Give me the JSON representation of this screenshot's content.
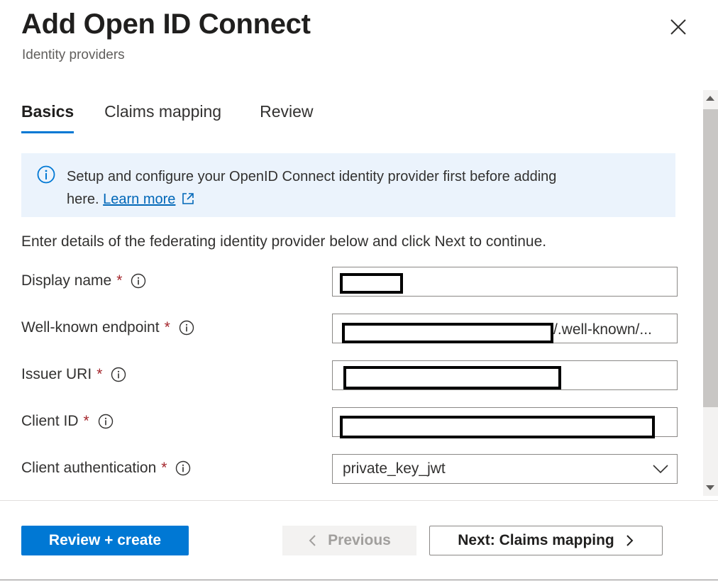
{
  "header": {
    "title": "Add Open ID Connect",
    "subtitle": "Identity providers"
  },
  "tabs": [
    {
      "label": "Basics",
      "active": true
    },
    {
      "label": "Claims mapping",
      "active": false
    },
    {
      "label": "Review",
      "active": false
    }
  ],
  "info": {
    "text_line1": "Setup and configure your OpenID Connect identity provider first before adding",
    "text_line2": "here.",
    "link_label": "Learn more"
  },
  "form": {
    "intro": "Enter details of the federating identity provider below and click Next to continue.",
    "required_mark": "*",
    "display_name": {
      "label": "Display name"
    },
    "well_known": {
      "label": "Well-known endpoint",
      "value_suffix": "/.well-known/..."
    },
    "issuer_uri": {
      "label": "Issuer URI"
    },
    "client_id": {
      "label": "Client ID"
    },
    "client_auth": {
      "label": "Client authentication",
      "value": "private_key_jwt"
    }
  },
  "footer": {
    "review_create": "Review + create",
    "previous": "Previous",
    "next": "Next: Claims mapping"
  },
  "colors": {
    "accent": "#0078d4",
    "info_background": "#ebf3fc",
    "required": "#a4262c",
    "link": "#0067b8"
  },
  "icons": {
    "close": "close-icon",
    "info": "info-circle-icon",
    "external_link": "external-link-icon",
    "chevron_down": "chevron-down-icon",
    "previous": "chevron-left-icon",
    "next": "chevron-right-icon"
  }
}
